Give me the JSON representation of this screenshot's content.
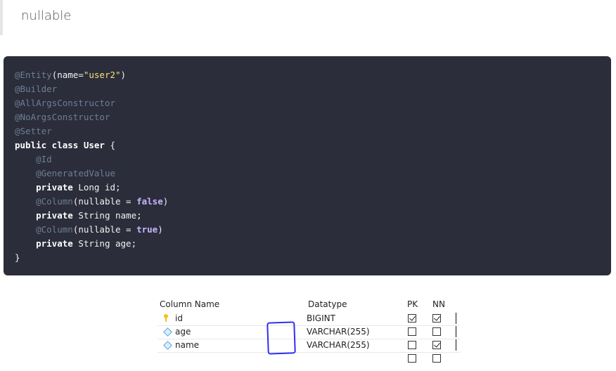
{
  "quote": {
    "text": "nullable"
  },
  "code": {
    "lines": [
      [
        "ann",
        "@Entity",
        "plain",
        "(name=",
        "str",
        "\"user2\"",
        "plain",
        ")"
      ],
      [
        "ann",
        "@Builder"
      ],
      [
        "ann",
        "@AllArgsConstructor"
      ],
      [
        "ann",
        "@NoArgsConstructor"
      ],
      [
        "ann",
        "@Setter"
      ],
      [
        "kw",
        "public class",
        "plain",
        " ",
        "kw",
        "User",
        "plain",
        " {"
      ],
      [
        "plain",
        "    ",
        "ann",
        "@Id"
      ],
      [
        "plain",
        "    ",
        "ann",
        "@GeneratedValue"
      ],
      [
        "plain",
        "    ",
        "kw",
        "private",
        "plain",
        " Long id;"
      ],
      [
        "plain",
        "    ",
        "ann",
        "@Column",
        "plain",
        "(nullable = ",
        "bool",
        "false",
        "plain",
        ")"
      ],
      [
        "plain",
        "    ",
        "kw",
        "private",
        "plain",
        " String name;"
      ],
      [
        "plain",
        "    ",
        "ann",
        "@Column",
        "plain",
        "(nullable = ",
        "bool",
        "true",
        "plain",
        ")"
      ],
      [
        "plain",
        "    ",
        "kw",
        "private",
        "plain",
        " String age;"
      ],
      [
        "plain",
        "}"
      ]
    ]
  },
  "table": {
    "headers": {
      "column_name": "Column Name",
      "datatype": "Datatype",
      "pk": "PK",
      "nn": "NN"
    },
    "rows": [
      {
        "icon": "key-icon",
        "name": "id",
        "datatype": "BIGINT",
        "pk": true,
        "nn": true
      },
      {
        "icon": "diamond-icon",
        "name": "age",
        "datatype": "VARCHAR(255)",
        "pk": false,
        "nn": false
      },
      {
        "icon": "diamond-icon",
        "name": "name",
        "datatype": "VARCHAR(255)",
        "pk": false,
        "nn": true
      },
      {
        "icon": "",
        "name": "",
        "datatype": "",
        "pk": false,
        "nn": false
      }
    ],
    "highlight_color": "#2f2ff2"
  }
}
